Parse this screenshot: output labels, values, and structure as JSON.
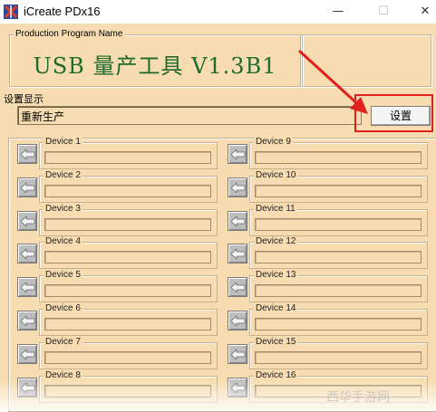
{
  "window": {
    "title": "iCreate PDx16",
    "minimize": "—",
    "maximize": "☐",
    "close": "✕"
  },
  "production": {
    "legend": "Production Program Name",
    "title": "USB 量产工具 V1.3B1"
  },
  "settings": {
    "legend": "设置显示",
    "value": "重新生产",
    "button_label": "设置"
  },
  "colors": {
    "background": "#f6dcb0",
    "title_green": "#1d6a2a",
    "highlight_red": "#e0201c"
  },
  "devices_left": [
    {
      "label": "Device 1"
    },
    {
      "label": "Device 2"
    },
    {
      "label": "Device 3"
    },
    {
      "label": "Device 4"
    },
    {
      "label": "Device 5"
    },
    {
      "label": "Device 6"
    },
    {
      "label": "Device 7"
    },
    {
      "label": "Device 8"
    }
  ],
  "devices_right": [
    {
      "label": "Device 9"
    },
    {
      "label": "Device 10"
    },
    {
      "label": "Device 11"
    },
    {
      "label": "Device 12"
    },
    {
      "label": "Device 13"
    },
    {
      "label": "Device 14"
    },
    {
      "label": "Device 15"
    },
    {
      "label": "Device 16"
    }
  ],
  "watermark": "西华手游网"
}
